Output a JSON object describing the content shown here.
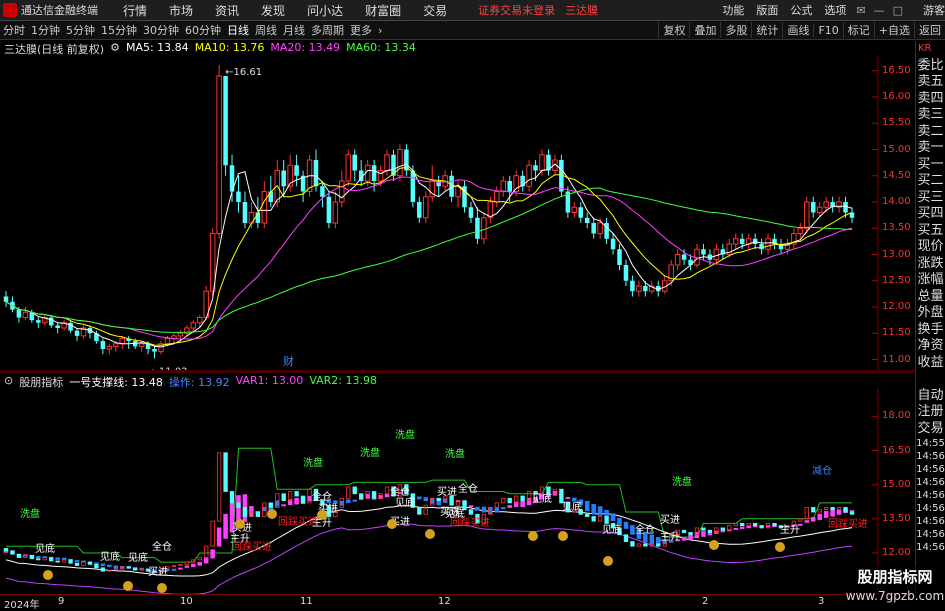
{
  "app": {
    "name": "通达信金融终端"
  },
  "menu": [
    "行情",
    "市场",
    "资讯",
    "发现",
    "问小达",
    "财富圈",
    "交易"
  ],
  "warnings": [
    "证券交易未登录",
    "三达膜"
  ],
  "right_menu": [
    "功能",
    "版面",
    "公式",
    "选项"
  ],
  "guest": "游客",
  "periods": [
    "分时",
    "1分钟",
    "5分钟",
    "15分钟",
    "30分钟",
    "60分钟",
    "日线",
    "周线",
    "月线",
    "多周期",
    "更多"
  ],
  "active_period": "日线",
  "right_tools": [
    "复权",
    "叠加",
    "多股",
    "统计",
    "画线",
    "F10",
    "标记",
    "+自选",
    "返回"
  ],
  "main_panel": {
    "title": "三达膜(日线 前复权)",
    "ma": [
      {
        "label": "MA5: 13.84",
        "color": "#ffffff"
      },
      {
        "label": "MA10: 13.76",
        "color": "#ffff00"
      },
      {
        "label": "MA20: 13.49",
        "color": "#ff40ff"
      },
      {
        "label": "MA60: 13.34",
        "color": "#40ff40"
      }
    ],
    "high_label": "16.61",
    "low_label": "11.02",
    "cai_label": "财",
    "y_ticks": [
      "16.50",
      "16.00",
      "15.50",
      "15.00",
      "14.50",
      "14.00",
      "13.50",
      "13.00",
      "12.50",
      "12.00",
      "11.50",
      "11.00"
    ]
  },
  "sub_panel": {
    "title": "股朋指标",
    "values": [
      {
        "label": "一号支撑线: 13.48",
        "color": "#ffffff"
      },
      {
        "label": "操作: 13.92",
        "color": "#4080ff"
      },
      {
        "label": "VAR1: 13.00",
        "color": "#ff40ff"
      },
      {
        "label": "VAR2: 13.98",
        "color": "#40ff40"
      }
    ],
    "y_ticks": [
      "18.00",
      "16.50",
      "15.00",
      "13.50",
      "12.00"
    ],
    "signals": [
      "洗盘",
      "洗盘",
      "洗盘",
      "洗盘",
      "洗盘",
      "洗盘",
      "减仓",
      "见底",
      "见底",
      "见底",
      "见底",
      "见底",
      "见底",
      "见底",
      "见底",
      "全仓",
      "全仓",
      "全仓",
      "全仓",
      "全仓",
      "买进",
      "买进",
      "买进",
      "买进",
      "买进",
      "买进",
      "买进",
      "主升",
      "主升",
      "主升",
      "主升",
      "回踩买进",
      "回踩买进",
      "回踩买进",
      "回踩买进"
    ]
  },
  "right_sidebar": [
    "KR",
    "委比",
    "卖五",
    "卖四",
    "卖三",
    "卖二",
    "卖一",
    "买一",
    "买二",
    "买三",
    "买四",
    "买五",
    "现价",
    "涨跌",
    "涨幅",
    "总量",
    "外盘",
    "换手",
    "净资",
    "收益",
    "",
    "自动",
    "注册",
    "交易",
    "14:55",
    "14:56",
    "14:56",
    "14:56",
    "14:56",
    "14:56",
    "14:56",
    "14:56",
    "14:56"
  ],
  "x_labels": [
    "2024年",
    "9",
    "10",
    "11",
    "12",
    "2",
    "3"
  ],
  "watermark": {
    "line1": "股朋指标网",
    "line2": "www.7gpzb.com"
  },
  "chart_data": {
    "type": "candlestick",
    "title": "三达膜(日线 前复权)",
    "ylim": [
      10.8,
      16.8
    ],
    "series": [
      {
        "name": "MA5",
        "value": 13.84
      },
      {
        "name": "MA10",
        "value": 13.76
      },
      {
        "name": "MA20",
        "value": 13.49
      },
      {
        "name": "MA60",
        "value": 13.34
      }
    ],
    "candles": [
      [
        12.2,
        12.1,
        12.3,
        12.0
      ],
      [
        12.1,
        11.95,
        12.2,
        11.9
      ],
      [
        11.95,
        11.8,
        12.0,
        11.7
      ],
      [
        11.8,
        11.9,
        12.0,
        11.75
      ],
      [
        11.9,
        11.75,
        11.95,
        11.7
      ],
      [
        11.75,
        11.7,
        11.8,
        11.6
      ],
      [
        11.7,
        11.8,
        11.85,
        11.65
      ],
      [
        11.8,
        11.65,
        11.85,
        11.6
      ],
      [
        11.65,
        11.6,
        11.7,
        11.5
      ],
      [
        11.6,
        11.7,
        11.75,
        11.55
      ],
      [
        11.7,
        11.55,
        11.75,
        11.5
      ],
      [
        11.55,
        11.45,
        11.6,
        11.35
      ],
      [
        11.45,
        11.6,
        11.65,
        11.4
      ],
      [
        11.6,
        11.5,
        11.65,
        11.4
      ],
      [
        11.5,
        11.35,
        11.55,
        11.3
      ],
      [
        11.35,
        11.2,
        11.4,
        11.1
      ],
      [
        11.2,
        11.25,
        11.3,
        11.1
      ],
      [
        11.25,
        11.3,
        11.35,
        11.15
      ],
      [
        11.3,
        11.4,
        11.45,
        11.2
      ],
      [
        11.4,
        11.35,
        11.45,
        11.2
      ],
      [
        11.35,
        11.25,
        11.4,
        11.2
      ],
      [
        11.25,
        11.3,
        11.35,
        11.15
      ],
      [
        11.3,
        11.2,
        11.35,
        11.1
      ],
      [
        11.2,
        11.15,
        11.25,
        11.02
      ],
      [
        11.15,
        11.3,
        11.35,
        11.1
      ],
      [
        11.3,
        11.4,
        11.45,
        11.25
      ],
      [
        11.4,
        11.45,
        11.5,
        11.3
      ],
      [
        11.45,
        11.5,
        11.55,
        11.35
      ],
      [
        11.5,
        11.6,
        11.65,
        11.45
      ],
      [
        11.6,
        11.7,
        11.75,
        11.5
      ],
      [
        11.7,
        11.8,
        11.85,
        11.6
      ],
      [
        11.8,
        12.3,
        12.4,
        11.75
      ],
      [
        12.3,
        13.4,
        13.5,
        12.2
      ],
      [
        13.4,
        16.4,
        16.61,
        13.3
      ],
      [
        16.4,
        14.7,
        15.5,
        14.5
      ],
      [
        14.7,
        14.2,
        14.9,
        14.0
      ],
      [
        14.2,
        14.0,
        14.5,
        13.8
      ],
      [
        14.0,
        13.6,
        14.2,
        13.5
      ],
      [
        13.6,
        13.8,
        14.0,
        13.5
      ],
      [
        13.8,
        13.6,
        14.1,
        13.5
      ],
      [
        13.6,
        14.2,
        14.4,
        13.5
      ],
      [
        14.2,
        14.0,
        14.5,
        13.9
      ],
      [
        14.0,
        14.6,
        14.8,
        13.9
      ],
      [
        14.6,
        14.3,
        14.8,
        14.1
      ],
      [
        14.3,
        14.7,
        14.9,
        14.2
      ],
      [
        14.7,
        14.5,
        14.9,
        14.3
      ],
      [
        14.5,
        14.2,
        14.6,
        14.0
      ],
      [
        14.2,
        14.8,
        14.9,
        14.1
      ],
      [
        14.8,
        14.3,
        15.0,
        14.2
      ],
      [
        14.3,
        14.1,
        14.4,
        13.9
      ],
      [
        14.1,
        13.6,
        14.2,
        13.5
      ],
      [
        13.6,
        14.0,
        14.2,
        13.5
      ],
      [
        14.0,
        14.4,
        14.6,
        13.9
      ],
      [
        14.4,
        14.9,
        15.0,
        14.3
      ],
      [
        14.9,
        14.6,
        15.0,
        14.4
      ],
      [
        14.6,
        14.4,
        14.8,
        14.3
      ],
      [
        14.4,
        14.7,
        14.8,
        14.3
      ],
      [
        14.7,
        14.4,
        14.8,
        14.2
      ],
      [
        14.4,
        14.6,
        14.7,
        14.3
      ],
      [
        14.6,
        14.9,
        15.0,
        14.5
      ],
      [
        14.9,
        14.5,
        15.0,
        14.4
      ],
      [
        14.5,
        15.0,
        15.1,
        14.4
      ],
      [
        15.0,
        14.6,
        15.1,
        14.5
      ],
      [
        14.6,
        14.0,
        14.7,
        13.9
      ],
      [
        14.0,
        13.7,
        14.1,
        13.6
      ],
      [
        13.7,
        14.1,
        14.2,
        13.6
      ],
      [
        14.1,
        14.4,
        14.7,
        14.0
      ],
      [
        14.4,
        14.3,
        14.5,
        14.1
      ],
      [
        14.3,
        14.5,
        14.6,
        14.2
      ],
      [
        14.5,
        14.1,
        14.6,
        14.0
      ],
      [
        14.1,
        14.3,
        14.4,
        13.9
      ],
      [
        14.3,
        13.9,
        14.4,
        13.8
      ],
      [
        13.9,
        13.7,
        14.0,
        13.6
      ],
      [
        13.7,
        13.3,
        13.9,
        13.2
      ],
      [
        13.3,
        13.7,
        13.8,
        13.2
      ],
      [
        13.7,
        14.0,
        14.1,
        13.6
      ],
      [
        14.0,
        14.2,
        14.3,
        13.9
      ],
      [
        14.2,
        14.4,
        14.5,
        14.1
      ],
      [
        14.4,
        14.2,
        14.5,
        14.0
      ],
      [
        14.2,
        14.5,
        14.6,
        14.1
      ],
      [
        14.5,
        14.3,
        14.6,
        14.2
      ],
      [
        14.3,
        14.7,
        14.8,
        14.2
      ],
      [
        14.7,
        14.6,
        14.8,
        14.4
      ],
      [
        14.6,
        14.9,
        15.0,
        14.5
      ],
      [
        14.9,
        14.6,
        15.0,
        14.5
      ],
      [
        14.6,
        14.8,
        14.9,
        14.5
      ],
      [
        14.8,
        14.2,
        14.9,
        14.1
      ],
      [
        14.2,
        13.8,
        14.3,
        13.7
      ],
      [
        13.8,
        13.9,
        14.0,
        13.7
      ],
      [
        13.9,
        13.7,
        14.0,
        13.6
      ],
      [
        13.7,
        13.6,
        13.8,
        13.5
      ],
      [
        13.6,
        13.4,
        13.7,
        13.3
      ],
      [
        13.4,
        13.6,
        13.7,
        13.3
      ],
      [
        13.6,
        13.3,
        13.7,
        13.2
      ],
      [
        13.3,
        13.1,
        13.4,
        13.0
      ],
      [
        13.1,
        12.8,
        13.2,
        12.7
      ],
      [
        12.8,
        12.5,
        12.9,
        12.4
      ],
      [
        12.5,
        12.3,
        12.6,
        12.2
      ],
      [
        12.3,
        12.4,
        12.5,
        12.2
      ],
      [
        12.4,
        12.3,
        12.5,
        12.2
      ],
      [
        12.3,
        12.4,
        12.5,
        12.25
      ],
      [
        12.4,
        12.3,
        12.5,
        12.2
      ],
      [
        12.3,
        12.5,
        12.6,
        12.25
      ],
      [
        12.5,
        12.8,
        12.9,
        12.4
      ],
      [
        12.8,
        13.0,
        13.1,
        12.7
      ],
      [
        13.0,
        12.9,
        13.1,
        12.8
      ],
      [
        12.9,
        12.8,
        13.0,
        12.7
      ],
      [
        12.8,
        13.1,
        13.2,
        12.75
      ],
      [
        13.1,
        13.0,
        13.2,
        12.9
      ],
      [
        13.0,
        12.9,
        13.1,
        12.8
      ],
      [
        12.9,
        13.1,
        13.2,
        12.8
      ],
      [
        13.1,
        13.0,
        13.2,
        12.9
      ],
      [
        13.0,
        13.2,
        13.3,
        12.95
      ],
      [
        13.2,
        13.3,
        13.4,
        13.1
      ],
      [
        13.3,
        13.2,
        13.4,
        13.1
      ],
      [
        13.2,
        13.3,
        13.4,
        13.1
      ],
      [
        13.3,
        13.2,
        13.4,
        13.1
      ],
      [
        13.2,
        13.1,
        13.3,
        13.0
      ],
      [
        13.1,
        13.3,
        13.4,
        13.0
      ],
      [
        13.3,
        13.2,
        13.4,
        13.1
      ],
      [
        13.2,
        13.1,
        13.3,
        13.0
      ],
      [
        13.1,
        13.2,
        13.3,
        13.0
      ],
      [
        13.2,
        13.4,
        13.5,
        13.1
      ],
      [
        13.4,
        13.5,
        13.6,
        13.3
      ],
      [
        13.5,
        14.0,
        14.1,
        13.4
      ],
      [
        14.0,
        13.8,
        14.1,
        13.7
      ],
      [
        13.8,
        13.9,
        14.0,
        13.7
      ],
      [
        13.9,
        14.0,
        14.1,
        13.8
      ],
      [
        14.0,
        13.9,
        14.1,
        13.8
      ],
      [
        13.9,
        14.0,
        14.1,
        13.8
      ],
      [
        14.0,
        13.8,
        14.1,
        13.7
      ],
      [
        13.8,
        13.7,
        13.9,
        13.6
      ]
    ]
  }
}
